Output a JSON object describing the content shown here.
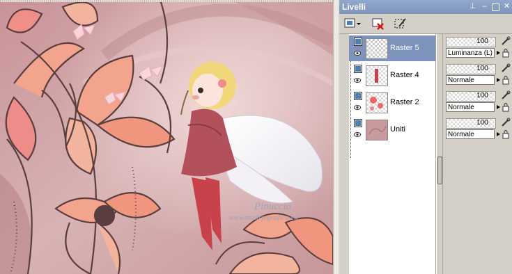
{
  "panel": {
    "title": "Livelli",
    "buttons": [
      "pin-icon",
      "minimize-icon",
      "maximize-icon",
      "close-icon"
    ]
  },
  "toolbar": {
    "tools": [
      "new-layer-icon",
      "delete-layer-icon",
      "edit-selection-icon"
    ]
  },
  "layers": [
    {
      "name": "Raster 5",
      "selected": true,
      "opacity": "100",
      "blend": "Luminanza (L)"
    },
    {
      "name": "Raster 4",
      "selected": false,
      "opacity": "100",
      "blend": "Normale"
    },
    {
      "name": "Raster 2",
      "selected": false,
      "opacity": "100",
      "blend": "Normale"
    },
    {
      "name": "Uniti",
      "selected": false,
      "opacity": "100",
      "blend": "Normale"
    }
  ],
  "canvas": {
    "watermark_name": "Pinuccia",
    "watermark_url": "www.madriegrafica.eu"
  },
  "colors": {
    "background": "#c99a9d",
    "petal": "#f2a48c",
    "stroke": "#5a3e3e",
    "panel_title": "#7d93bb"
  }
}
